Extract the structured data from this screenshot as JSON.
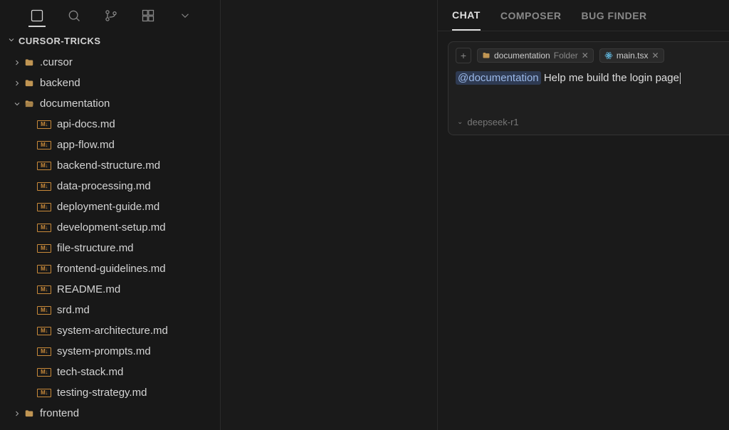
{
  "explorer": {
    "title": "CURSOR-TRICKS",
    "tree": [
      {
        "name": ".cursor",
        "type": "folder",
        "expanded": false,
        "depth": 0
      },
      {
        "name": "backend",
        "type": "folder",
        "expanded": false,
        "depth": 0
      },
      {
        "name": "documentation",
        "type": "folder",
        "expanded": true,
        "depth": 0
      },
      {
        "name": "api-docs.md",
        "type": "file",
        "depth": 1
      },
      {
        "name": "app-flow.md",
        "type": "file",
        "depth": 1
      },
      {
        "name": "backend-structure.md",
        "type": "file",
        "depth": 1
      },
      {
        "name": "data-processing.md",
        "type": "file",
        "depth": 1
      },
      {
        "name": "deployment-guide.md",
        "type": "file",
        "depth": 1
      },
      {
        "name": "development-setup.md",
        "type": "file",
        "depth": 1
      },
      {
        "name": "file-structure.md",
        "type": "file",
        "depth": 1
      },
      {
        "name": "frontend-guidelines.md",
        "type": "file",
        "depth": 1
      },
      {
        "name": "README.md",
        "type": "file",
        "depth": 1
      },
      {
        "name": "srd.md",
        "type": "file",
        "depth": 1
      },
      {
        "name": "system-architecture.md",
        "type": "file",
        "depth": 1
      },
      {
        "name": "system-prompts.md",
        "type": "file",
        "depth": 1
      },
      {
        "name": "tech-stack.md",
        "type": "file",
        "depth": 1
      },
      {
        "name": "testing-strategy.md",
        "type": "file",
        "depth": 1
      },
      {
        "name": "frontend",
        "type": "folder",
        "expanded": false,
        "depth": 0
      }
    ]
  },
  "panel": {
    "tabs": {
      "chat": "CHAT",
      "composer": "COMPOSER",
      "bugfinder": "BUG FINDER"
    }
  },
  "chat": {
    "chips": {
      "doc_name": "documentation",
      "doc_type": "Folder",
      "main_name": "main.tsx"
    },
    "mention": "@documentation",
    "input_text": "Help me build the login page",
    "model": "deepseek-r1",
    "md_badge": "M↓"
  }
}
